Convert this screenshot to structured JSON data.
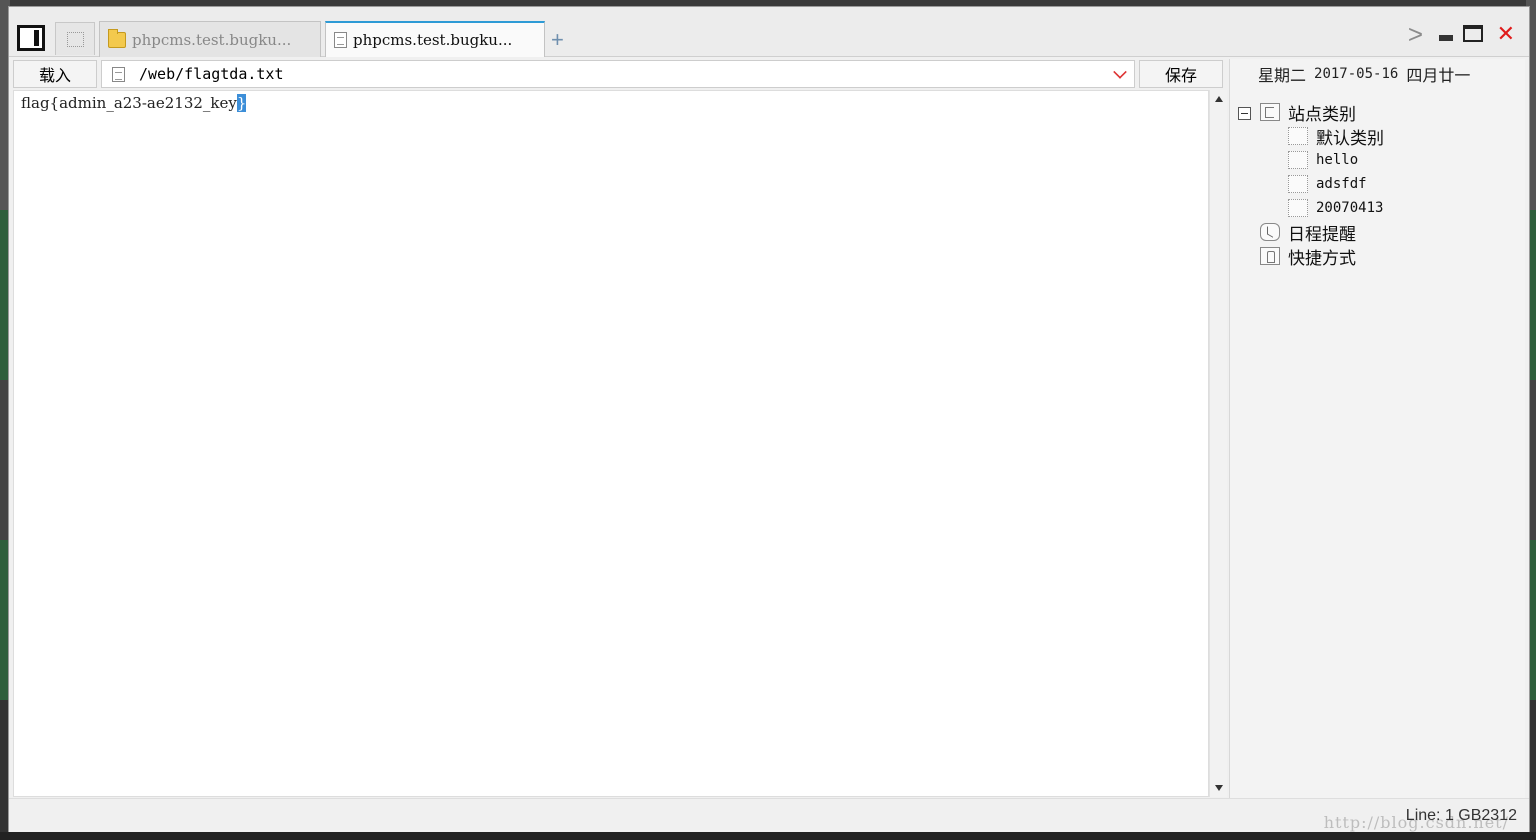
{
  "tabs": [
    {
      "label": "phpcms.test.bugku...",
      "active": false,
      "icon": "folder-icon"
    },
    {
      "label": "phpcms.test.bugku...",
      "active": true,
      "icon": "file-icon"
    }
  ],
  "new_tab_label": "+",
  "window_controls": {
    "chevron": ">",
    "close": "✕"
  },
  "toolbar": {
    "load_label": "载入",
    "path": "/web/flagtda.txt",
    "save_label": "保存"
  },
  "editor": {
    "content_before_selection": "flag{admin_a23-ae2132_key",
    "selected_text": "}"
  },
  "side_panel": {
    "weekday": "星期二",
    "date": "2017-05-16",
    "lunar_date": "四月廿一",
    "tree": {
      "root_label": "站点类别",
      "children": [
        "默认类别",
        "hello",
        "adsfdf",
        "20070413"
      ],
      "schedule_label": "日程提醒",
      "shortcut_label": "快捷方式"
    }
  },
  "status": {
    "text": "Line: 1  GB2312",
    "watermark": "http://blog.csdn.net/"
  },
  "colors": {
    "accent": "#2e9bd6",
    "selection": "#3c8ed8",
    "close": "#e01b1b",
    "dropdown_arrow": "#dd3333"
  }
}
